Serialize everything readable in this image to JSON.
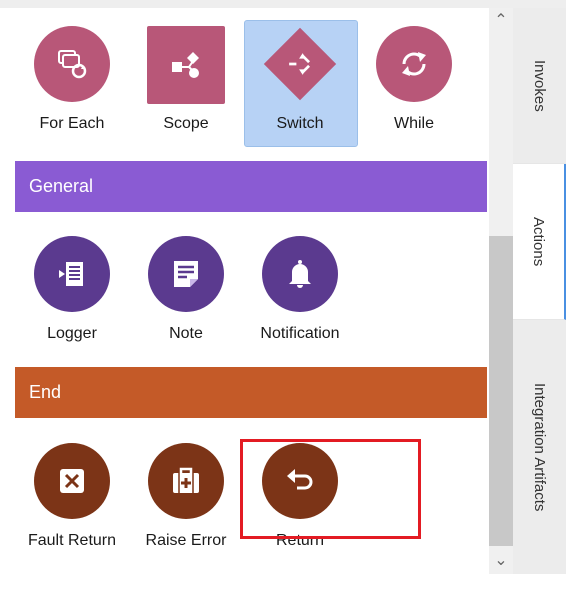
{
  "colors": {
    "loop_pink": "#b85778",
    "general_purple": "#8a5bd3",
    "general_icon": "#5b3a8f",
    "end_orange": "#c45a28",
    "end_icon": "#7c3417",
    "selected_bg": "#b7d2f5",
    "highlight_red": "#e31b23",
    "active_tab_accent": "#4a90e2"
  },
  "loop_items": [
    {
      "label": "For Each",
      "icon": "for-each-icon"
    },
    {
      "label": "Scope",
      "icon": "scope-icon"
    },
    {
      "label": "Switch",
      "icon": "switch-icon",
      "selected": true
    },
    {
      "label": "While",
      "icon": "while-icon"
    }
  ],
  "sections": {
    "general": {
      "title": "General",
      "items": [
        {
          "label": "Logger",
          "icon": "logger-icon"
        },
        {
          "label": "Note",
          "icon": "note-icon"
        },
        {
          "label": "Notification",
          "icon": "notification-bell-icon"
        }
      ]
    },
    "end": {
      "title": "End",
      "items": [
        {
          "label": "Fault Return",
          "icon": "fault-return-icon"
        },
        {
          "label": "Raise Error",
          "icon": "raise-error-icon"
        },
        {
          "label": "Return",
          "icon": "return-arrow-icon"
        }
      ]
    }
  },
  "sidebar_tabs": [
    {
      "label": "Invokes"
    },
    {
      "label": "Actions",
      "active": true
    },
    {
      "label": "Integration Artifacts"
    }
  ],
  "scrollbar": {
    "up_glyph": "⌃",
    "down_glyph": "⌄"
  }
}
